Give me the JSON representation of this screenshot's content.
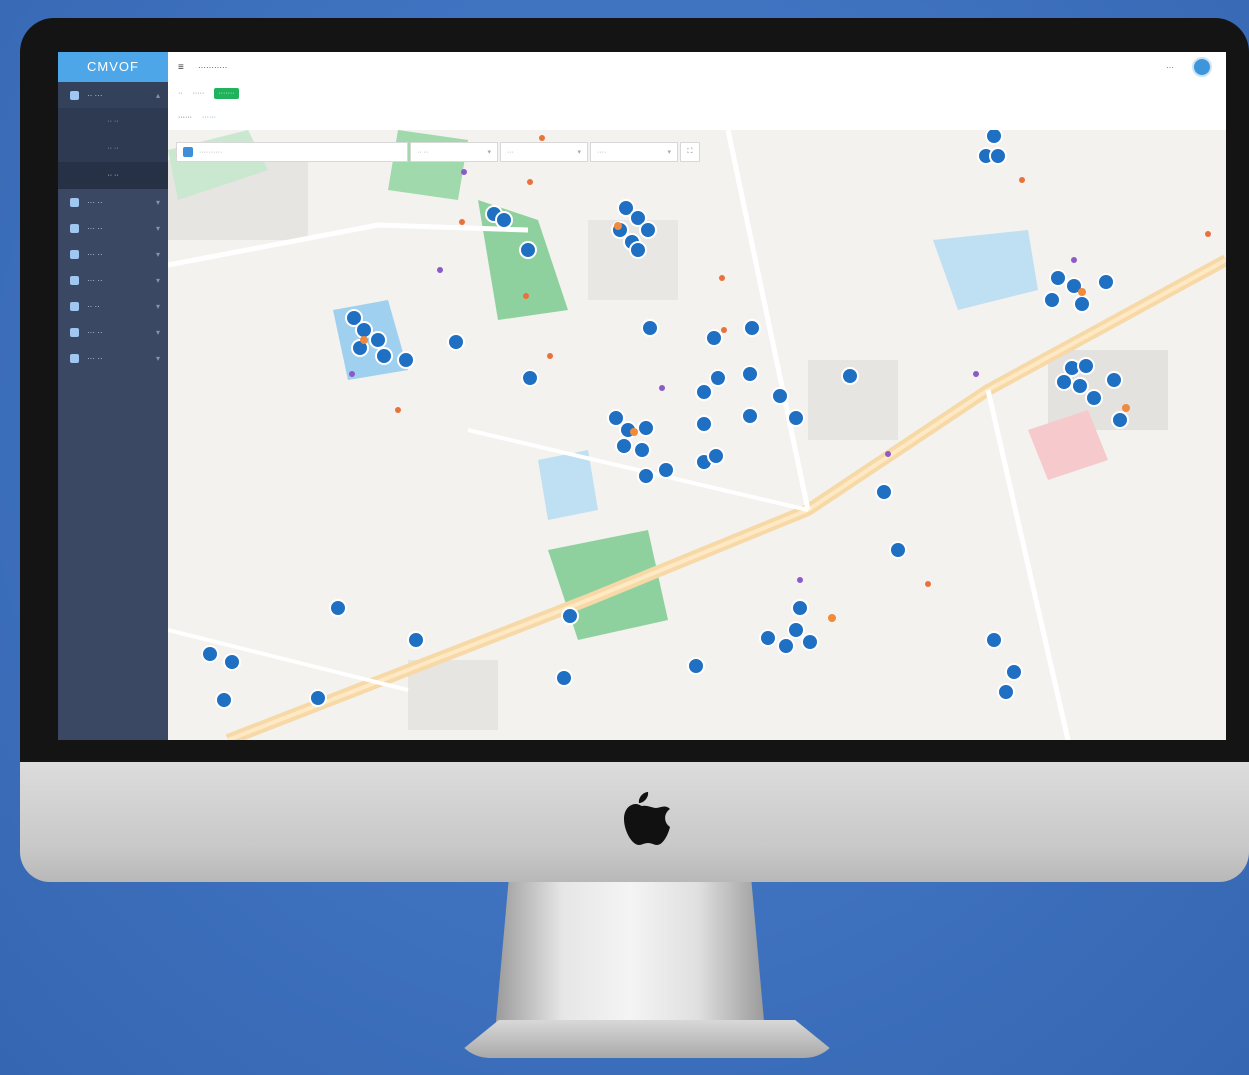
{
  "brand": {
    "logo_text": "CMVOF"
  },
  "sidebar": {
    "items": [
      {
        "label": "·· ···",
        "open": true
      },
      {
        "label": "··· ··"
      },
      {
        "label": "··· ··"
      },
      {
        "label": "··· ··"
      },
      {
        "label": "··· ··"
      },
      {
        "label": "·· ··"
      },
      {
        "label": "··· ··"
      },
      {
        "label": "··· ··"
      }
    ],
    "sub_items": [
      {
        "label": "·· ··"
      },
      {
        "label": "·· ··"
      },
      {
        "label": "·· ··",
        "active": true
      }
    ]
  },
  "topbar": {
    "title": "···········",
    "user": "···"
  },
  "breadcrumb": {
    "home": "··",
    "second": "·····",
    "tag": "·······"
  },
  "tabs": {
    "first": "······",
    "second": "······"
  },
  "filters": {
    "search_placeholder": "··········",
    "select1": "·· ··",
    "select2": "···",
    "select3": "····"
  },
  "colors": {
    "accent": "#4da6e8",
    "sidebar": "#3a4863",
    "marker": "#1f6fc2",
    "road": "#f6d9a7",
    "park": "#8fd19e",
    "water": "#bfe0f2"
  },
  "icons": {
    "menu": "menu-icon",
    "avatar": "avatar",
    "search": "search-icon",
    "marker": "marker-icon"
  }
}
